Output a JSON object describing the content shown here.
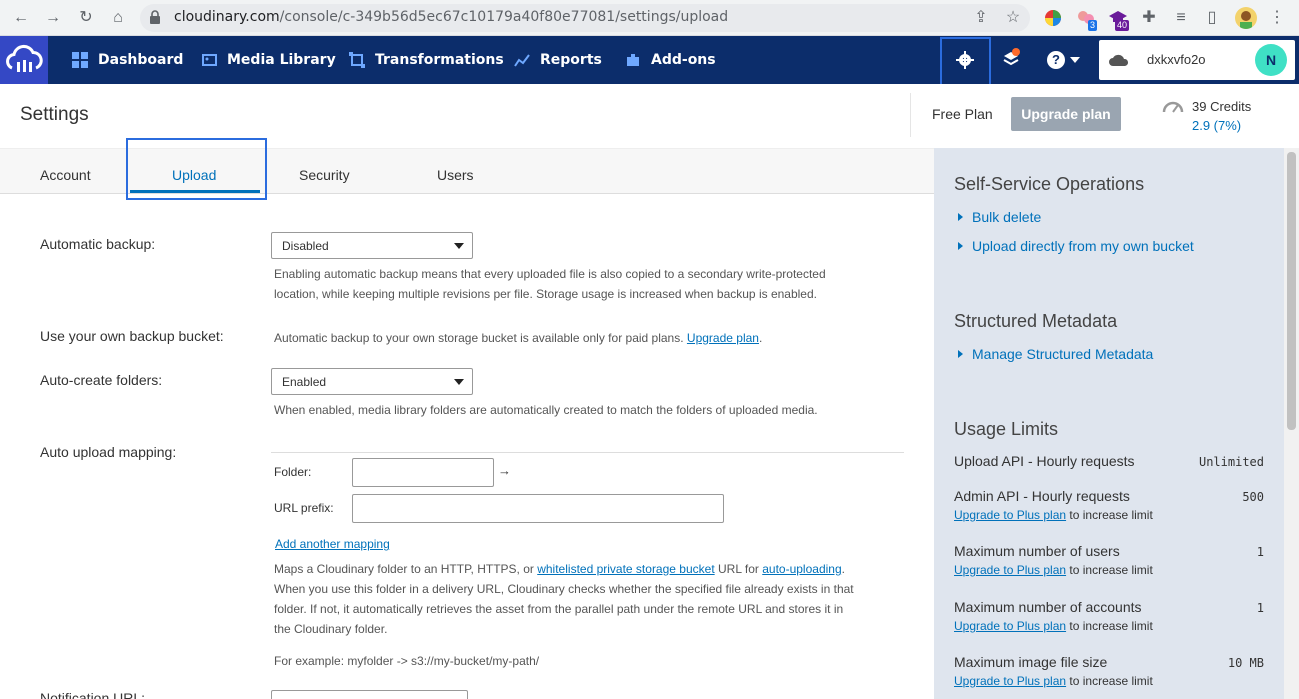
{
  "browser": {
    "url_host": "cloudinary.com",
    "url_path": "/console/c-349b56d5ec67c10179a40f80e77081/settings/upload",
    "ext_badge_1": "3",
    "ext_badge_2": "40"
  },
  "nav": {
    "items": [
      {
        "label": "Dashboard",
        "icon": "dashboard-icon"
      },
      {
        "label": "Media Library",
        "icon": "media-library-icon"
      },
      {
        "label": "Transformations",
        "icon": "transformations-icon"
      },
      {
        "label": "Reports",
        "icon": "reports-icon"
      },
      {
        "label": "Add-ons",
        "icon": "addons-icon"
      }
    ],
    "help": "?",
    "account_name": "dxkxvfo2o",
    "avatar_initial": "N"
  },
  "header": {
    "title": "Settings",
    "plan": "Free Plan",
    "upgrade_label": "Upgrade plan",
    "credits": "39 Credits",
    "credits_pct": "2.9 (7%)"
  },
  "tabs": [
    {
      "label": "Account"
    },
    {
      "label": "Upload"
    },
    {
      "label": "Security"
    },
    {
      "label": "Users"
    }
  ],
  "form": {
    "backup_label": "Automatic backup:",
    "backup_value": "Disabled",
    "backup_help_1": "Enabling automatic backup means that every uploaded file is also copied to a secondary write-protected",
    "backup_help_2": "location, while keeping multiple revisions per file. Storage usage is increased when backup is enabled.",
    "bucket_label": "Use your own backup bucket:",
    "bucket_help": "Automatic backup to your own storage bucket is available only for paid plans.",
    "bucket_link": "Upgrade plan",
    "folders_label": "Auto-create folders:",
    "folders_value": "Enabled",
    "folders_help": "When enabled, media library folders are automatically created to match the folders of uploaded media.",
    "mapping_label": "Auto upload mapping:",
    "folder_label": "Folder:",
    "arrow": "→",
    "prefix_label": "URL prefix:",
    "add_mapping": "Add another mapping",
    "map_help_1a": "Maps a Cloudinary folder to an HTTP, HTTPS, or ",
    "map_help_1link": "whitelisted private storage bucket",
    "map_help_1b": " URL for ",
    "map_help_1link2": "auto-uploading",
    "map_help_1c": ".",
    "map_help_2": "When you use this folder in a delivery URL, Cloudinary checks whether the specified file already exists in that",
    "map_help_3": "folder. If not, it automatically retrieves the asset from the parallel path under the remote URL and stores it in",
    "map_help_4": "the Cloudinary folder.",
    "map_example": "For example: myfolder -> s3://my-bucket/my-path/",
    "notif_label": "Notification URL:"
  },
  "right": {
    "ops_title": "Self-Service Operations",
    "ops_links": [
      "Bulk delete",
      "Upload directly from my own bucket"
    ],
    "meta_title": "Structured Metadata",
    "meta_link": "Manage Structured Metadata",
    "limits_title": "Usage Limits",
    "upgrade_link": "Upgrade to Plus plan",
    "upgrade_suffix": " to increase limit",
    "limits": [
      {
        "label": "Upload API - Hourly requests",
        "value": "Unlimited"
      },
      {
        "label": "Admin API - Hourly requests",
        "value": "500"
      },
      {
        "label": "Maximum number of users",
        "value": "1"
      },
      {
        "label": "Maximum number of accounts",
        "value": "1"
      },
      {
        "label": "Maximum image file size",
        "value": "10 MB"
      }
    ]
  },
  "colors": {
    "nav_bg": "#0c2d6b",
    "accent": "#0071ba",
    "panel_bg": "#dfe5ee",
    "highlight": "#2b6cde"
  }
}
